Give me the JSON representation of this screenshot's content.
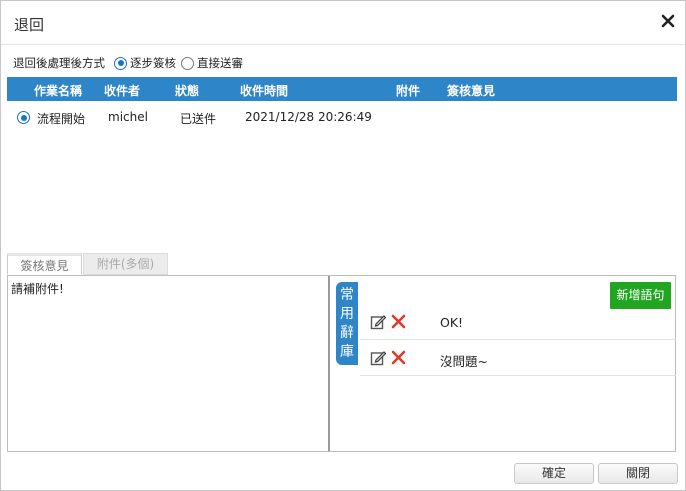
{
  "dialog": {
    "title": "退回"
  },
  "return_method": {
    "label": "退回後處理後方式",
    "options": [
      {
        "label": "逐步簽核",
        "selected": true
      },
      {
        "label": "直接送審",
        "selected": false
      }
    ]
  },
  "grid": {
    "columns": [
      "作業名稱",
      "收件者",
      "狀態",
      "收件時間",
      "附件",
      "簽核意見"
    ],
    "rows": [
      {
        "selected": true,
        "task": "流程開始",
        "recipient": "michel",
        "status": "已送件",
        "received": "2021/12/28 20:26:49",
        "attachment": "",
        "opinion": ""
      }
    ]
  },
  "tabs": [
    "簽核意見",
    "附件(多個)"
  ],
  "opinion_text": "請補附件!",
  "phrases": {
    "tab_label": "常用辭庫",
    "add_label": "新增語句",
    "items": [
      "OK!",
      "沒問題~"
    ]
  },
  "footer": {
    "confirm": "確定",
    "close": "關閉"
  },
  "colors": {
    "header_blue": "#2e86c9",
    "add_green": "#22a622",
    "delete_red": "#e0392b"
  },
  "icons": {
    "close": "close-icon",
    "edit": "edit-icon",
    "delete": "delete-icon"
  }
}
